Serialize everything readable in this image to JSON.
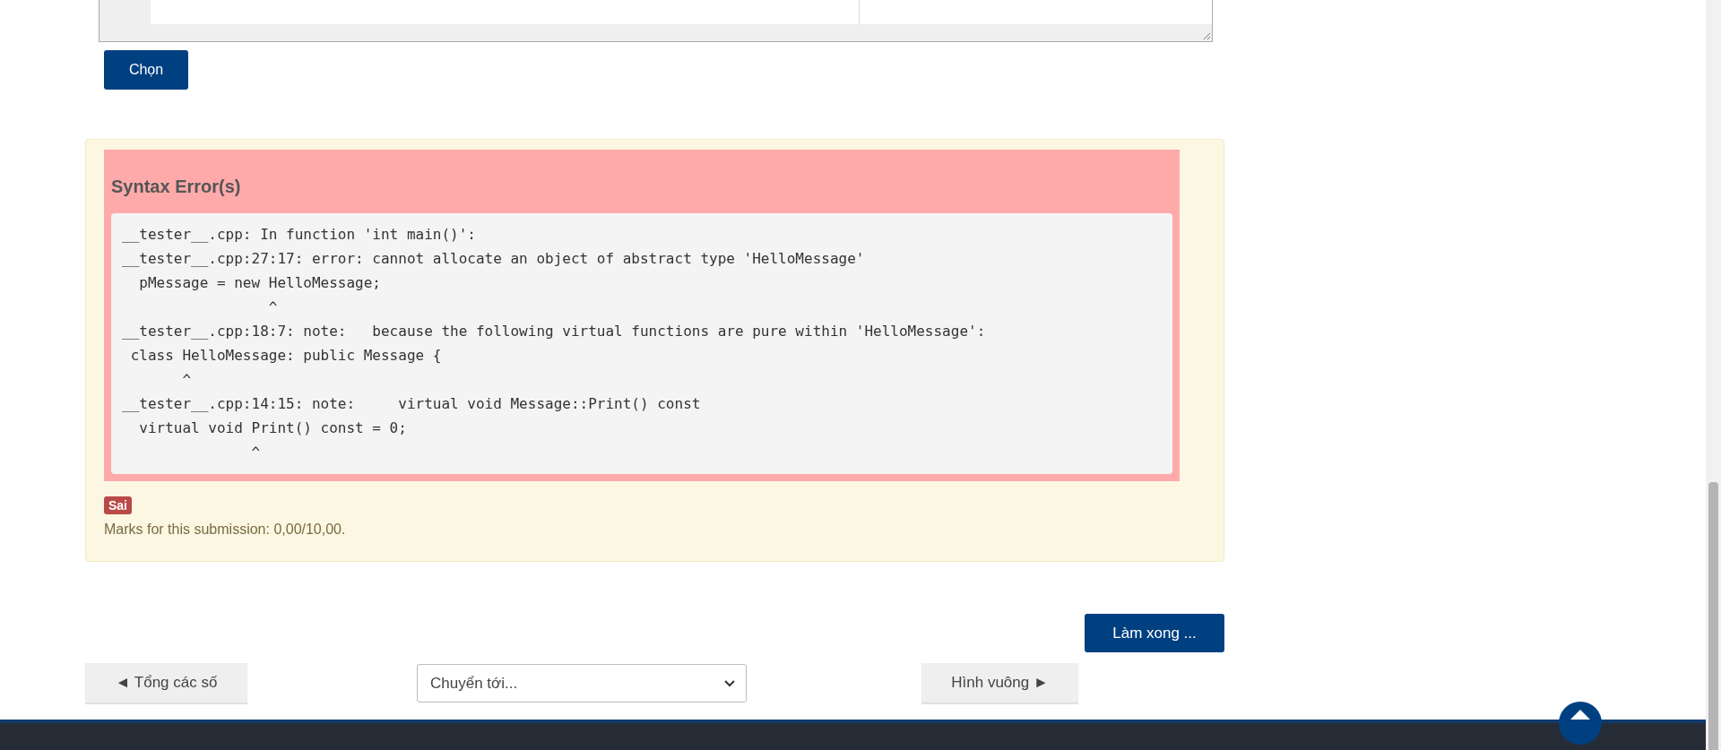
{
  "choose_button": {
    "label": "Chọn"
  },
  "feedback": {
    "title": "Syntax Error(s)",
    "error_output": "__tester__.cpp: In function 'int main()':\n__tester__.cpp:27:17: error: cannot allocate an object of abstract type 'HelloMessage'\n  pMessage = new HelloMessage;\n                 ^\n__tester__.cpp:18:7: note:   because the following virtual functions are pure within 'HelloMessage':\n class HelloMessage: public Message {\n       ^\n__tester__.cpp:14:15: note:     virtual void Message::Print() const\n  virtual void Print() const = 0;\n               ^",
    "badge": "Sai",
    "marks": "Marks for this submission: 0,00/10,00."
  },
  "finish_button": {
    "label": "Làm xong ..."
  },
  "navigation": {
    "previous": "◄ Tổng các số",
    "jump_select": {
      "value": "Chuyển tới..."
    },
    "next": "Hình vuông ►"
  }
}
